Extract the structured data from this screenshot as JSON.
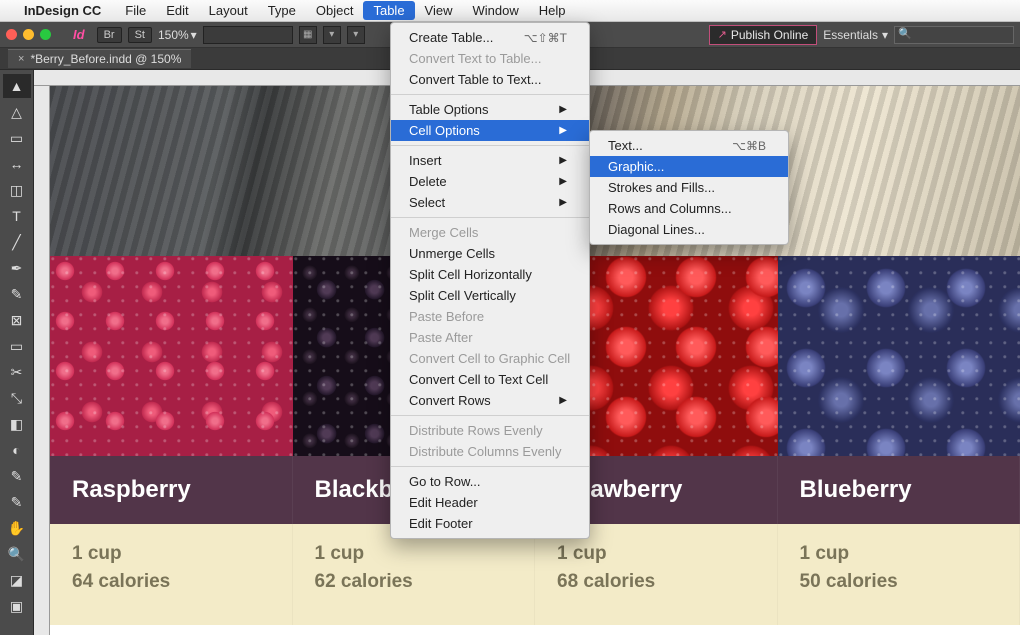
{
  "menubar": {
    "apple": "",
    "app": "InDesign CC",
    "items": [
      "File",
      "Edit",
      "Layout",
      "Type",
      "Object",
      "Table",
      "View",
      "Window",
      "Help"
    ],
    "active": "Table"
  },
  "controlbar": {
    "zoom": "150%",
    "publish": "Publish Online",
    "workspace": "Essentials"
  },
  "tab": {
    "title": "*Berry_Before.indd @ 150%"
  },
  "tools": [
    "arrow",
    "direct-select",
    "page",
    "gap",
    "content-collector",
    "type",
    "line",
    "pen",
    "pencil",
    "rectangle-frame",
    "rectangle",
    "scissors",
    "free-transform",
    "gradient-swatch",
    "gradient-feather",
    "note",
    "eyedropper",
    "hand",
    "zoom",
    "fill-stroke",
    "mode"
  ],
  "document": {
    "berries": [
      {
        "name": "Raspberry",
        "serving": "1 cup",
        "calories": "64 calories",
        "class": "raspberry"
      },
      {
        "name": "Blackberry",
        "serving": "1 cup",
        "calories": "62 calories",
        "class": "blackberry"
      },
      {
        "name": "Strawberry",
        "serving": "1 cup",
        "calories": "68 calories",
        "class": "strawberry"
      },
      {
        "name": "Blueberry",
        "serving": "1 cup",
        "calories": "50 calories",
        "class": "blueberry"
      }
    ]
  },
  "menu_table": {
    "groups": [
      [
        {
          "label": "Create Table...",
          "shortcut": "⌥⇧⌘T"
        },
        {
          "label": "Convert Text to Table...",
          "disabled": true
        },
        {
          "label": "Convert Table to Text..."
        }
      ],
      [
        {
          "label": "Table Options",
          "submenu": true
        },
        {
          "label": "Cell Options",
          "submenu": true,
          "highlight": true
        }
      ],
      [
        {
          "label": "Insert",
          "submenu": true
        },
        {
          "label": "Delete",
          "submenu": true
        },
        {
          "label": "Select",
          "submenu": true
        }
      ],
      [
        {
          "label": "Merge Cells",
          "disabled": true
        },
        {
          "label": "Unmerge Cells"
        },
        {
          "label": "Split Cell Horizontally"
        },
        {
          "label": "Split Cell Vertically"
        },
        {
          "label": "Paste Before",
          "disabled": true
        },
        {
          "label": "Paste After",
          "disabled": true
        },
        {
          "label": "Convert Cell to Graphic Cell",
          "disabled": true
        },
        {
          "label": "Convert Cell to Text Cell"
        },
        {
          "label": "Convert Rows",
          "submenu": true
        }
      ],
      [
        {
          "label": "Distribute Rows Evenly",
          "disabled": true
        },
        {
          "label": "Distribute Columns Evenly",
          "disabled": true
        }
      ],
      [
        {
          "label": "Go to Row..."
        },
        {
          "label": "Edit Header"
        },
        {
          "label": "Edit Footer"
        }
      ]
    ]
  },
  "menu_cell": {
    "items": [
      {
        "label": "Text...",
        "shortcut": "⌥⌘B"
      },
      {
        "label": "Graphic...",
        "highlight": true
      },
      {
        "label": "Strokes and Fills..."
      },
      {
        "label": "Rows and Columns..."
      },
      {
        "label": "Diagonal Lines..."
      }
    ]
  }
}
